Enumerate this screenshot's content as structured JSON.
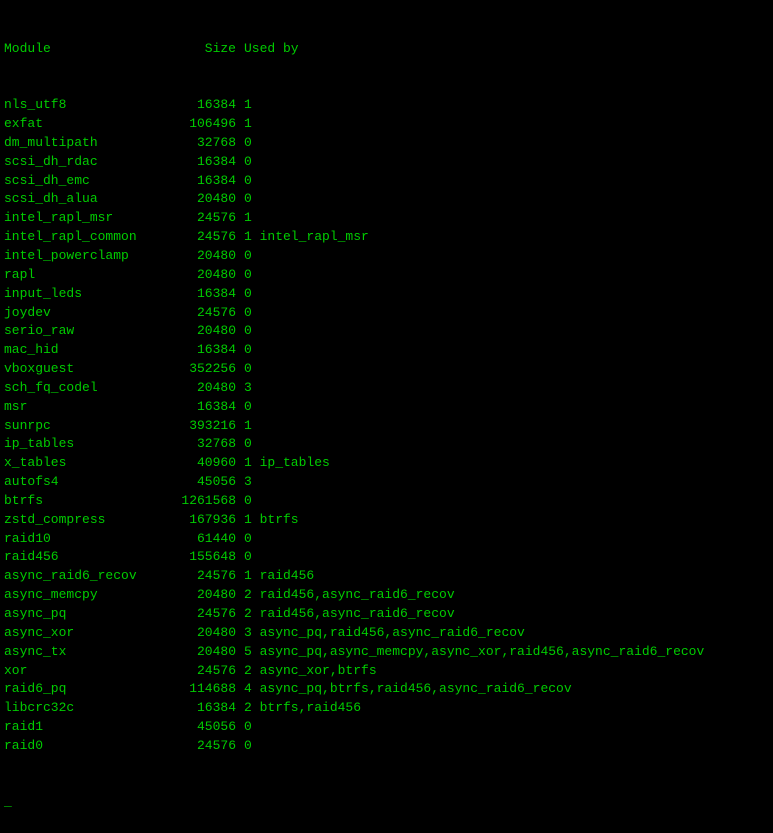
{
  "header": {
    "col1": "Module",
    "col2": "Size",
    "col3": "Used by"
  },
  "rows": [
    {
      "module": "nls_utf8",
      "size": "16384",
      "usedby": "1"
    },
    {
      "module": "exfat",
      "size": "106496",
      "usedby": "1"
    },
    {
      "module": "dm_multipath",
      "size": "32768",
      "usedby": "0"
    },
    {
      "module": "scsi_dh_rdac",
      "size": "16384",
      "usedby": "0"
    },
    {
      "module": "scsi_dh_emc",
      "size": "16384",
      "usedby": "0"
    },
    {
      "module": "scsi_dh_alua",
      "size": "20480",
      "usedby": "0"
    },
    {
      "module": "intel_rapl_msr",
      "size": "24576",
      "usedby": "1"
    },
    {
      "module": "intel_rapl_common",
      "size": "24576",
      "usedby": "1 intel_rapl_msr"
    },
    {
      "module": "intel_powerclamp",
      "size": "20480",
      "usedby": "0"
    },
    {
      "module": "rapl",
      "size": "20480",
      "usedby": "0"
    },
    {
      "module": "input_leds",
      "size": "16384",
      "usedby": "0"
    },
    {
      "module": "joydev",
      "size": "24576",
      "usedby": "0"
    },
    {
      "module": "serio_raw",
      "size": "20480",
      "usedby": "0"
    },
    {
      "module": "mac_hid",
      "size": "16384",
      "usedby": "0"
    },
    {
      "module": "vboxguest",
      "size": "352256",
      "usedby": "0"
    },
    {
      "module": "sch_fq_codel",
      "size": "20480",
      "usedby": "3"
    },
    {
      "module": "msr",
      "size": "16384",
      "usedby": "0"
    },
    {
      "module": "sunrpc",
      "size": "393216",
      "usedby": "1"
    },
    {
      "module": "ip_tables",
      "size": "32768",
      "usedby": "0"
    },
    {
      "module": "x_tables",
      "size": "40960",
      "usedby": "1 ip_tables"
    },
    {
      "module": "autofs4",
      "size": "45056",
      "usedby": "3"
    },
    {
      "module": "btrfs",
      "size": "1261568",
      "usedby": "0"
    },
    {
      "module": "zstd_compress",
      "size": "167936",
      "usedby": "1 btrfs"
    },
    {
      "module": "raid10",
      "size": "61440",
      "usedby": "0"
    },
    {
      "module": "raid456",
      "size": "155648",
      "usedby": "0"
    },
    {
      "module": "async_raid6_recov",
      "size": "24576",
      "usedby": "1 raid456"
    },
    {
      "module": "async_memcpy",
      "size": "20480",
      "usedby": "2 raid456,async_raid6_recov"
    },
    {
      "module": "async_pq",
      "size": "24576",
      "usedby": "2 raid456,async_raid6_recov"
    },
    {
      "module": "async_xor",
      "size": "20480",
      "usedby": "3 async_pq,raid456,async_raid6_recov"
    },
    {
      "module": "async_tx",
      "size": "20480",
      "usedby": "5 async_pq,async_memcpy,async_xor,raid456,async_raid6_recov"
    },
    {
      "module": "xor",
      "size": "24576",
      "usedby": "2 async_xor,btrfs"
    },
    {
      "module": "raid6_pq",
      "size": "114688",
      "usedby": "4 async_pq,btrfs,raid456,async_raid6_recov"
    },
    {
      "module": "libcrc32c",
      "size": "16384",
      "usedby": "2 btrfs,raid456"
    },
    {
      "module": "raid1",
      "size": "45056",
      "usedby": "0"
    },
    {
      "module": "raid0",
      "size": "24576",
      "usedby": "0"
    }
  ],
  "prompt": "_"
}
